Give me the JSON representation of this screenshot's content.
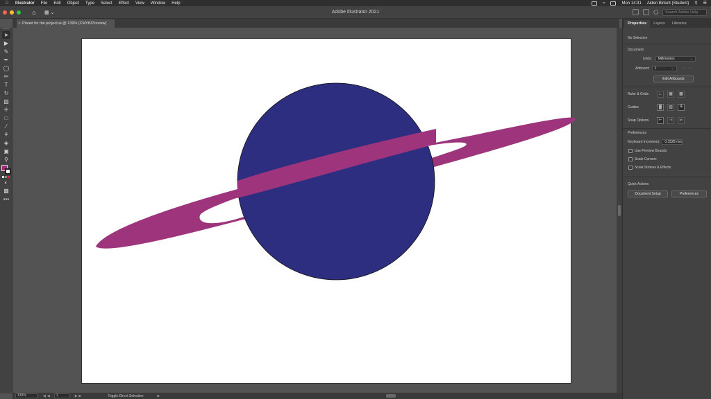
{
  "menubar": {
    "app": "Illustrator",
    "items": [
      "File",
      "Edit",
      "Object",
      "Type",
      "Select",
      "Effect",
      "View",
      "Window",
      "Help"
    ],
    "clock": "Mon 14:31",
    "user": "Aiden Birkett (Student)"
  },
  "appbar": {
    "title": "Adobe Illustrator 2021",
    "search_placeholder": "Search Adobe Help"
  },
  "document": {
    "tab_label": "Planet for the project.ai @ 139% (CMYK/Preview)"
  },
  "artwork": {
    "planet_color": "#2e2e80",
    "ring_color": "#9e357c"
  },
  "toolbar": {
    "tools": [
      "selection",
      "direct-selection",
      "pen",
      "curvature",
      "ellipse",
      "paintbrush",
      "type",
      "rotate",
      "eraser",
      "width",
      "gradient",
      "eyedropper",
      "blend",
      "shape-builder",
      "artboard",
      "zoom"
    ],
    "fill_color": "#9e2f7e",
    "more_label": "•••"
  },
  "statusbar": {
    "zoom": "139%",
    "page": "1",
    "status": "Toggle Direct Selection"
  },
  "panel": {
    "tabs": [
      "Properties",
      "Layers",
      "Libraries"
    ],
    "selection": "No Selection",
    "document_heading": "Document",
    "units_label": "Units:",
    "units_value": "Millimeters",
    "artboard_label": "Artboard:",
    "artboard_value": "1",
    "edit_artboards": "Edit Artboards",
    "ruler_grids": "Ruler & Grids",
    "guides": "Guides",
    "snap_options": "Snap Options",
    "preferences_heading": "Preferences",
    "keyboard_increment_label": "Keyboard Increment:",
    "keyboard_increment_value": "0.3528 mm",
    "use_preview_bounds": "Use Preview Bounds",
    "scale_corners": "Scale Corners",
    "scale_strokes": "Scale Strokes & Effects",
    "quick_actions": "Quick Actions",
    "document_setup": "Document Setup",
    "preferences_btn": "Preferences"
  }
}
